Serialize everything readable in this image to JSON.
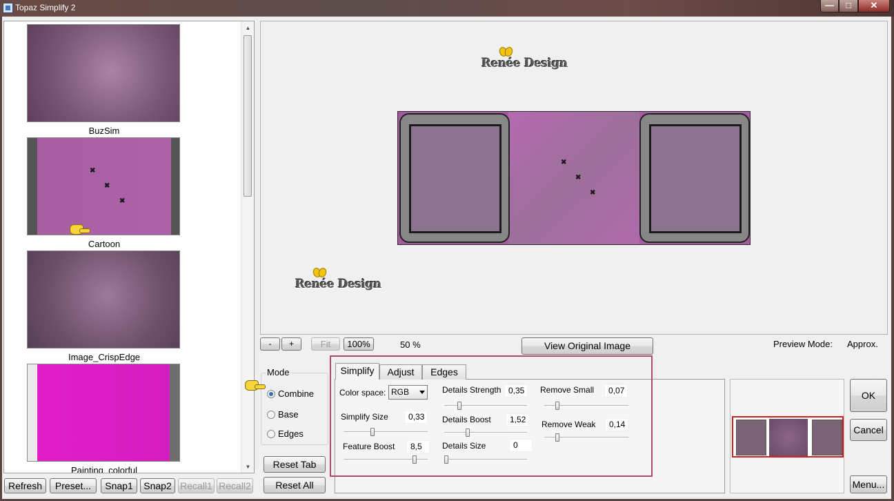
{
  "window": {
    "title": "Topaz Simplify 2",
    "controls": {
      "minimize": "—",
      "maximize": "□",
      "close": "✕"
    }
  },
  "presets": {
    "items": [
      {
        "label": "BuzSim"
      },
      {
        "label": "Cartoon"
      },
      {
        "label": "Image_CrispEdge"
      },
      {
        "label": "Painting_colorful"
      }
    ],
    "buttons": {
      "refresh": "Refresh",
      "preset": "Preset...",
      "snap1": "Snap1",
      "snap2": "Snap2",
      "recall1": "Recall1",
      "recall2": "Recall2"
    }
  },
  "preview": {
    "watermark": "Renée Design",
    "zoom_out": "-",
    "zoom_in": "+",
    "fit": "Fit",
    "zoom_100": "100%",
    "zoom_level": "50  %",
    "view_original": "View Original Image",
    "preview_mode_label": "Preview Mode:",
    "preview_mode_value": "Approx."
  },
  "mode": {
    "title": "Mode",
    "options": [
      "Combine",
      "Base",
      "Edges"
    ],
    "selected": "Combine",
    "reset_tab": "Reset Tab",
    "reset_all": "Reset All"
  },
  "tabs": {
    "items": [
      "Simplify",
      "Adjust",
      "Edges"
    ],
    "active": "Simplify"
  },
  "simplify": {
    "color_space_label": "Color space:",
    "color_space_value": "RGB",
    "simplify_size": {
      "label": "Simplify Size",
      "value": "0,33"
    },
    "feature_boost": {
      "label": "Feature Boost",
      "value": "8,5"
    },
    "details_strength": {
      "label": "Details Strength",
      "value": "0,35"
    },
    "details_boost": {
      "label": "Details Boost",
      "value": "1,52"
    },
    "details_size": {
      "label": "Details Size",
      "value": "0"
    },
    "remove_small": {
      "label": "Remove Small",
      "value": "0,07"
    },
    "remove_weak": {
      "label": "Remove Weak",
      "value": "0,14"
    }
  },
  "actions": {
    "ok": "OK",
    "cancel": "Cancel",
    "menu": "Menu..."
  },
  "colors": {
    "highlight_frame": "#b04a6c",
    "navigator_frame": "#d21e1e"
  }
}
